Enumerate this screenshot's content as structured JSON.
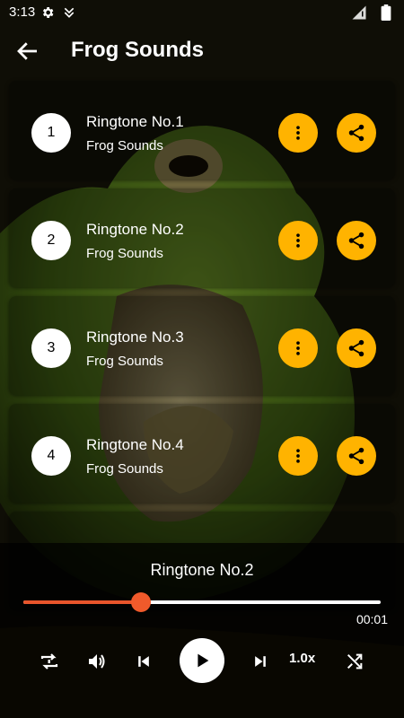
{
  "status_bar": {
    "time": "3:13",
    "icons": [
      "gear-icon",
      "vpn-icon",
      "wifi-icon",
      "battery-icon"
    ]
  },
  "header": {
    "title": "Frog Sounds",
    "back_icon": "arrow-left-icon"
  },
  "ringtones": [
    {
      "number": "1",
      "name": "Ringtone No.1",
      "subtitle": "Frog Sounds"
    },
    {
      "number": "2",
      "name": "Ringtone No.2",
      "subtitle": "Frog Sounds"
    },
    {
      "number": "3",
      "name": "Ringtone No.3",
      "subtitle": "Frog Sounds"
    },
    {
      "number": "4",
      "name": "Ringtone No.4",
      "subtitle": "Frog Sounds"
    }
  ],
  "player": {
    "now_playing": "Ringtone No.2",
    "progress": 0.33,
    "elapsed": "00:01",
    "speed": "1.0x"
  },
  "colors": {
    "accent": "#ffb300",
    "progress": "#e8552b",
    "background": "#000000"
  }
}
